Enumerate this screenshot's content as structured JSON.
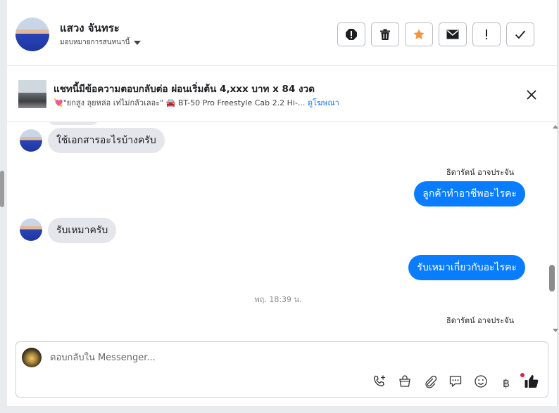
{
  "header": {
    "contact_name": "แสวง จันทระ",
    "assign_label": "มอบหมายการสนทนานี้",
    "actions": [
      {
        "icon": "alert-icon",
        "label": "report-spam"
      },
      {
        "icon": "trash-icon",
        "label": "delete"
      },
      {
        "icon": "star-icon",
        "label": "star"
      },
      {
        "icon": "envelope-icon",
        "label": "mark-unread"
      },
      {
        "icon": "exclamation-icon",
        "label": "follow-up"
      },
      {
        "icon": "check-icon",
        "label": "done"
      }
    ],
    "star_color": "#f7923b"
  },
  "ad": {
    "title": "แชทนี้มีข้อความตอบกลับต่อ ผ่อนเริ่มต้น 4,xxx บาท x 84 งวด",
    "subtitle_prefix": "💘\"ยกสูง ลุยหล่อ เท่ไม่กลัวเลอะ\" 🚘 BT-50 Pro Freestyle Cab 2.2 Hi-...",
    "link_text": "ดูโฆษณา"
  },
  "messages": {
    "in_1": "ใช้เอกสารอะไรบ้างครับ",
    "sender_1": "ธิดารัตน์ อาจประจัน",
    "out_1": "ลูกค้าทำอาชีพอะไรคะ",
    "in_2": "รับเหมาครับ",
    "out_2": "รับเหมาเกี่ยวกับอะไรคะ",
    "timestamp": "พฤ. 18:39 น.",
    "sender_2": "ธิดารัตน์ อาจประจัน"
  },
  "composer": {
    "placeholder": "ตอบกลับใน Messenger...",
    "value": "",
    "tools": [
      "phone-plus-icon",
      "shopping-bag-icon",
      "paperclip-icon",
      "chat-bubble-icon",
      "emoji-icon",
      "baht-icon",
      "thumbs-up-icon"
    ],
    "baht_symbol": "฿"
  },
  "colors": {
    "accent": "#0a7cff",
    "link": "#1877f2",
    "incoming_bubble": "#e4e6eb",
    "notification_dot": "#e41e3f"
  }
}
